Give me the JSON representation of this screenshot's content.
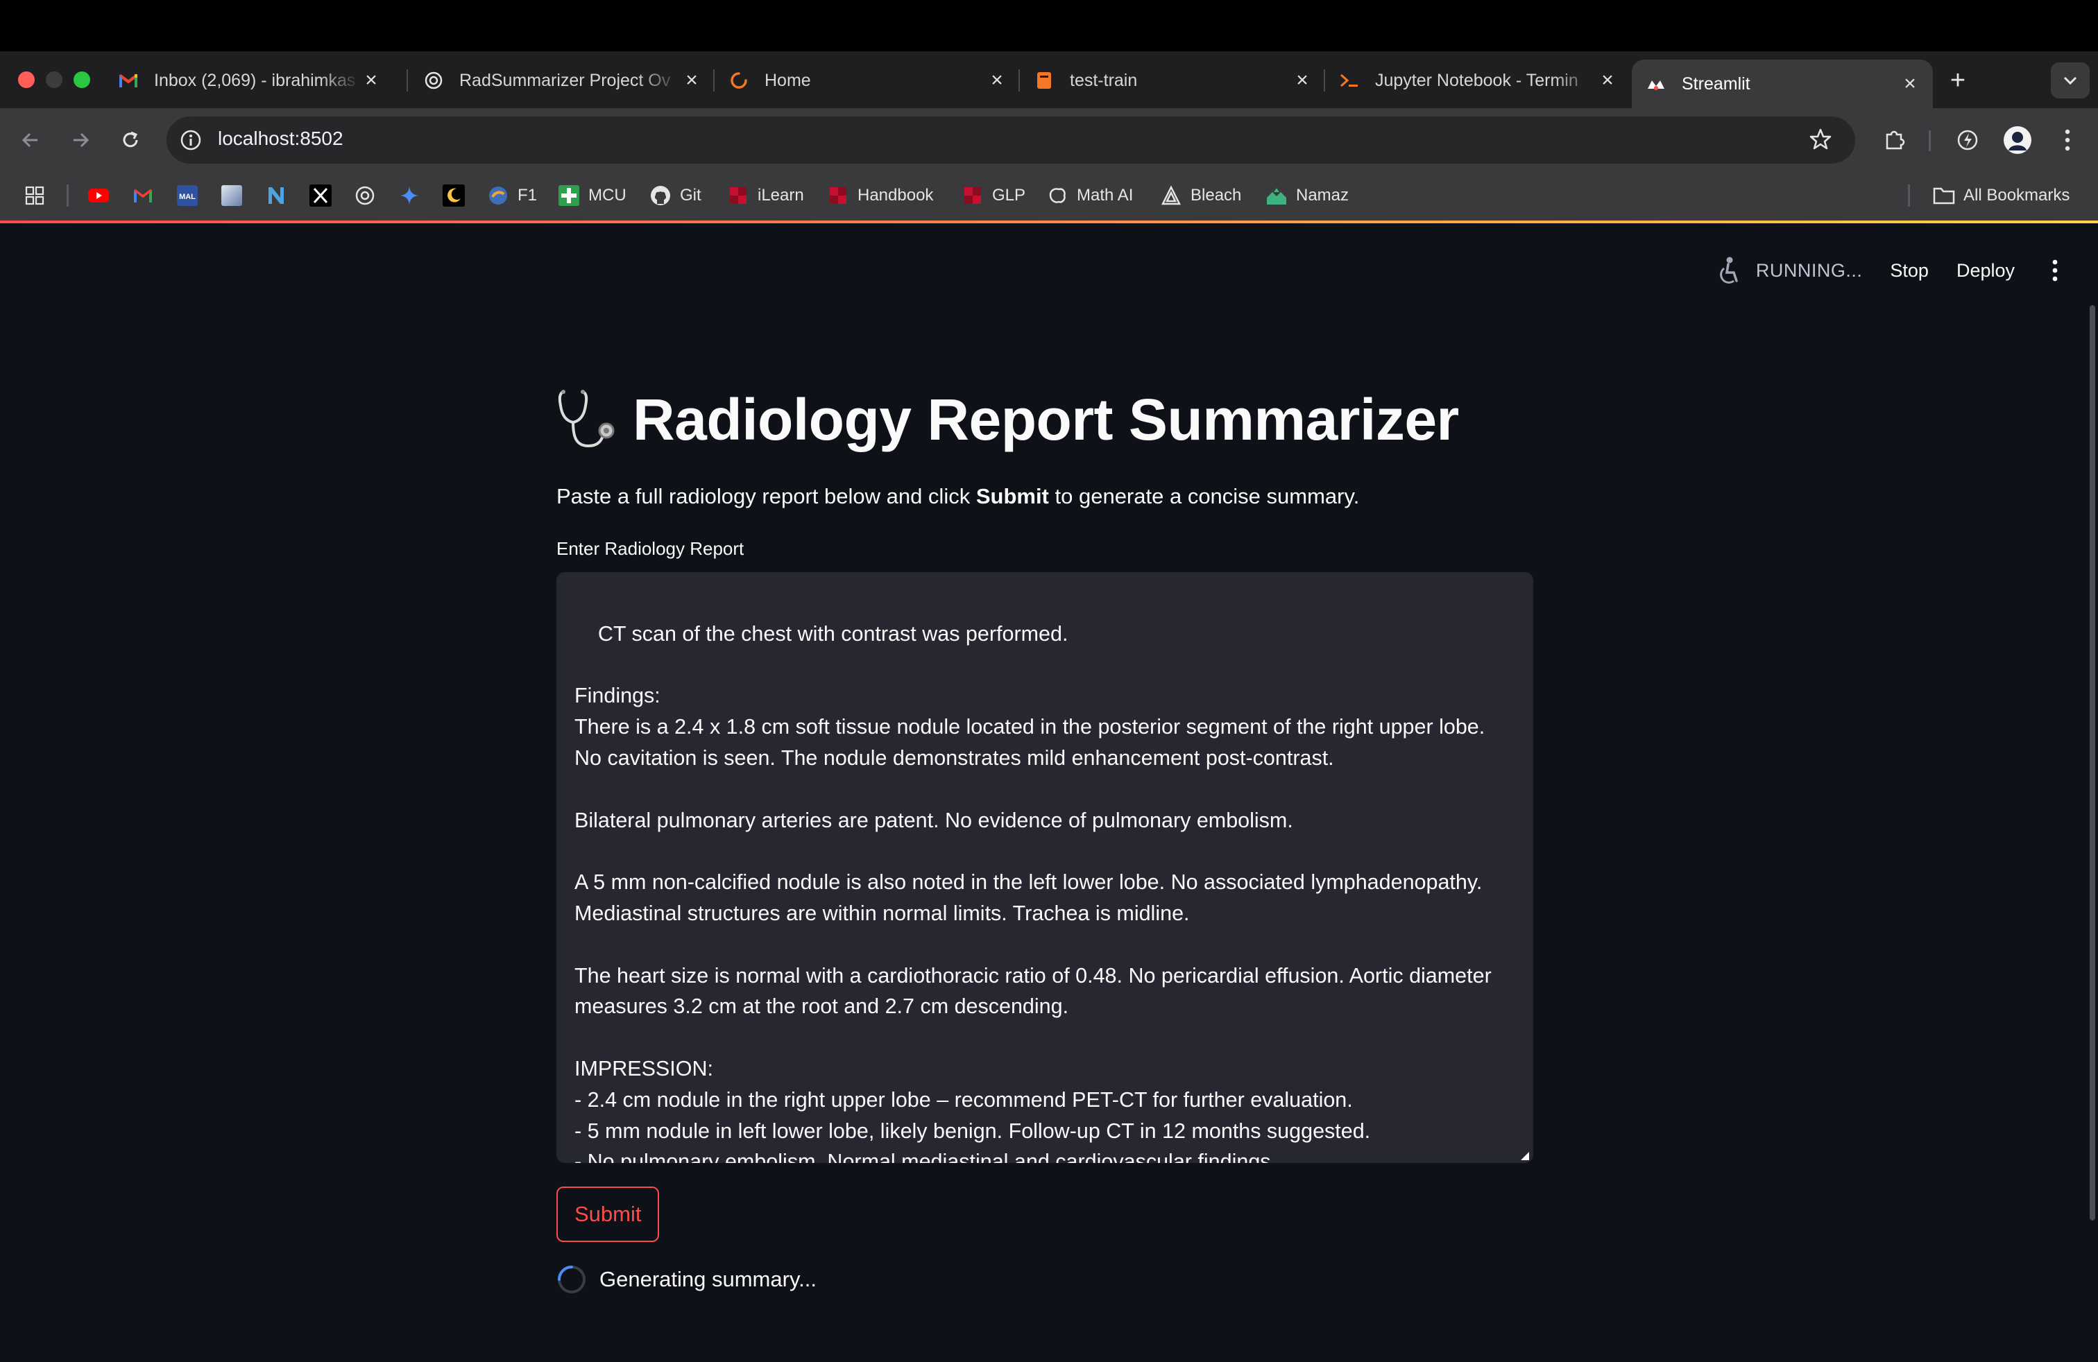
{
  "browser": {
    "tabs": [
      {
        "title": "Inbox (2,069) - ibrahimkas",
        "icon": "gmail-icon"
      },
      {
        "title": "RadSummarizer Project Ov",
        "icon": "chatgpt-icon"
      },
      {
        "title": "Home",
        "icon": "loading-icon"
      },
      {
        "title": "test-train",
        "icon": "notebook-icon"
      },
      {
        "title": "Jupyter Notebook - Termin",
        "icon": "terminal-icon"
      },
      {
        "title": "Streamlit",
        "icon": "streamlit-icon",
        "active": true
      }
    ],
    "url": "localhost:8502",
    "bookmarks": [
      {
        "label": "",
        "icon": "youtube-icon"
      },
      {
        "label": "",
        "icon": "gmail-icon"
      },
      {
        "label": "",
        "icon": "mal-icon"
      },
      {
        "label": "",
        "icon": "image-icon"
      },
      {
        "label": "",
        "icon": "notion-icon"
      },
      {
        "label": "",
        "icon": "x-icon"
      },
      {
        "label": "",
        "icon": "chatgpt-icon"
      },
      {
        "label": "",
        "icon": "gemini-icon"
      },
      {
        "label": "",
        "icon": "moon-icon"
      },
      {
        "label": "F1",
        "icon": "f1-icon"
      },
      {
        "label": "MCU",
        "icon": "mcu-icon"
      },
      {
        "label": "Git",
        "icon": "github-icon"
      },
      {
        "label": "iLearn",
        "icon": "ilearn-icon"
      },
      {
        "label": "Handbook",
        "icon": "handbook-icon"
      },
      {
        "label": "GLP",
        "icon": "glp-icon"
      },
      {
        "label": "Math AI",
        "icon": "mathai-icon"
      },
      {
        "label": "Bleach",
        "icon": "bleach-icon"
      },
      {
        "label": "Namaz",
        "icon": "mosque-icon"
      }
    ],
    "all_bookmarks": "All Bookmarks"
  },
  "app": {
    "status": "RUNNING...",
    "stop": "Stop",
    "deploy": "Deploy",
    "title": "Radiology Report Summarizer",
    "subtitle_pre": "Paste a full radiology report below and click ",
    "subtitle_bold": "Submit",
    "subtitle_post": " to generate a concise summary.",
    "input_label": "Enter Radiology Report",
    "report_text": "CT scan of the chest with contrast was performed.\n\nFindings:\nThere is a 2.4 x 1.8 cm soft tissue nodule located in the posterior segment of the right upper lobe. No cavitation is seen. The nodule demonstrates mild enhancement post-contrast.\n\nBilateral pulmonary arteries are patent. No evidence of pulmonary embolism.\n\nA 5 mm non-calcified nodule is also noted in the left lower lobe. No associated lymphadenopathy. Mediastinal structures are within normal limits. Trachea is midline.\n\nThe heart size is normal with a cardiothoracic ratio of 0.48. No pericardial effusion. Aortic diameter measures 3.2 cm at the root and 2.7 cm descending.\n\nIMPRESSION:\n- 2.4 cm nodule in the right upper lobe – recommend PET-CT for further evaluation.\n- 5 mm nodule in left lower lobe, likely benign. Follow-up CT in 12 months suggested.\n- No pulmonary embolism. Normal mediastinal and cardiovascular findings.",
    "submit": "Submit",
    "spinner_text": "Generating summary..."
  },
  "colors": {
    "app_bg": "#0e1117",
    "input_bg": "#262730",
    "accent": "#ff4b4b",
    "text": "#fafafa"
  }
}
